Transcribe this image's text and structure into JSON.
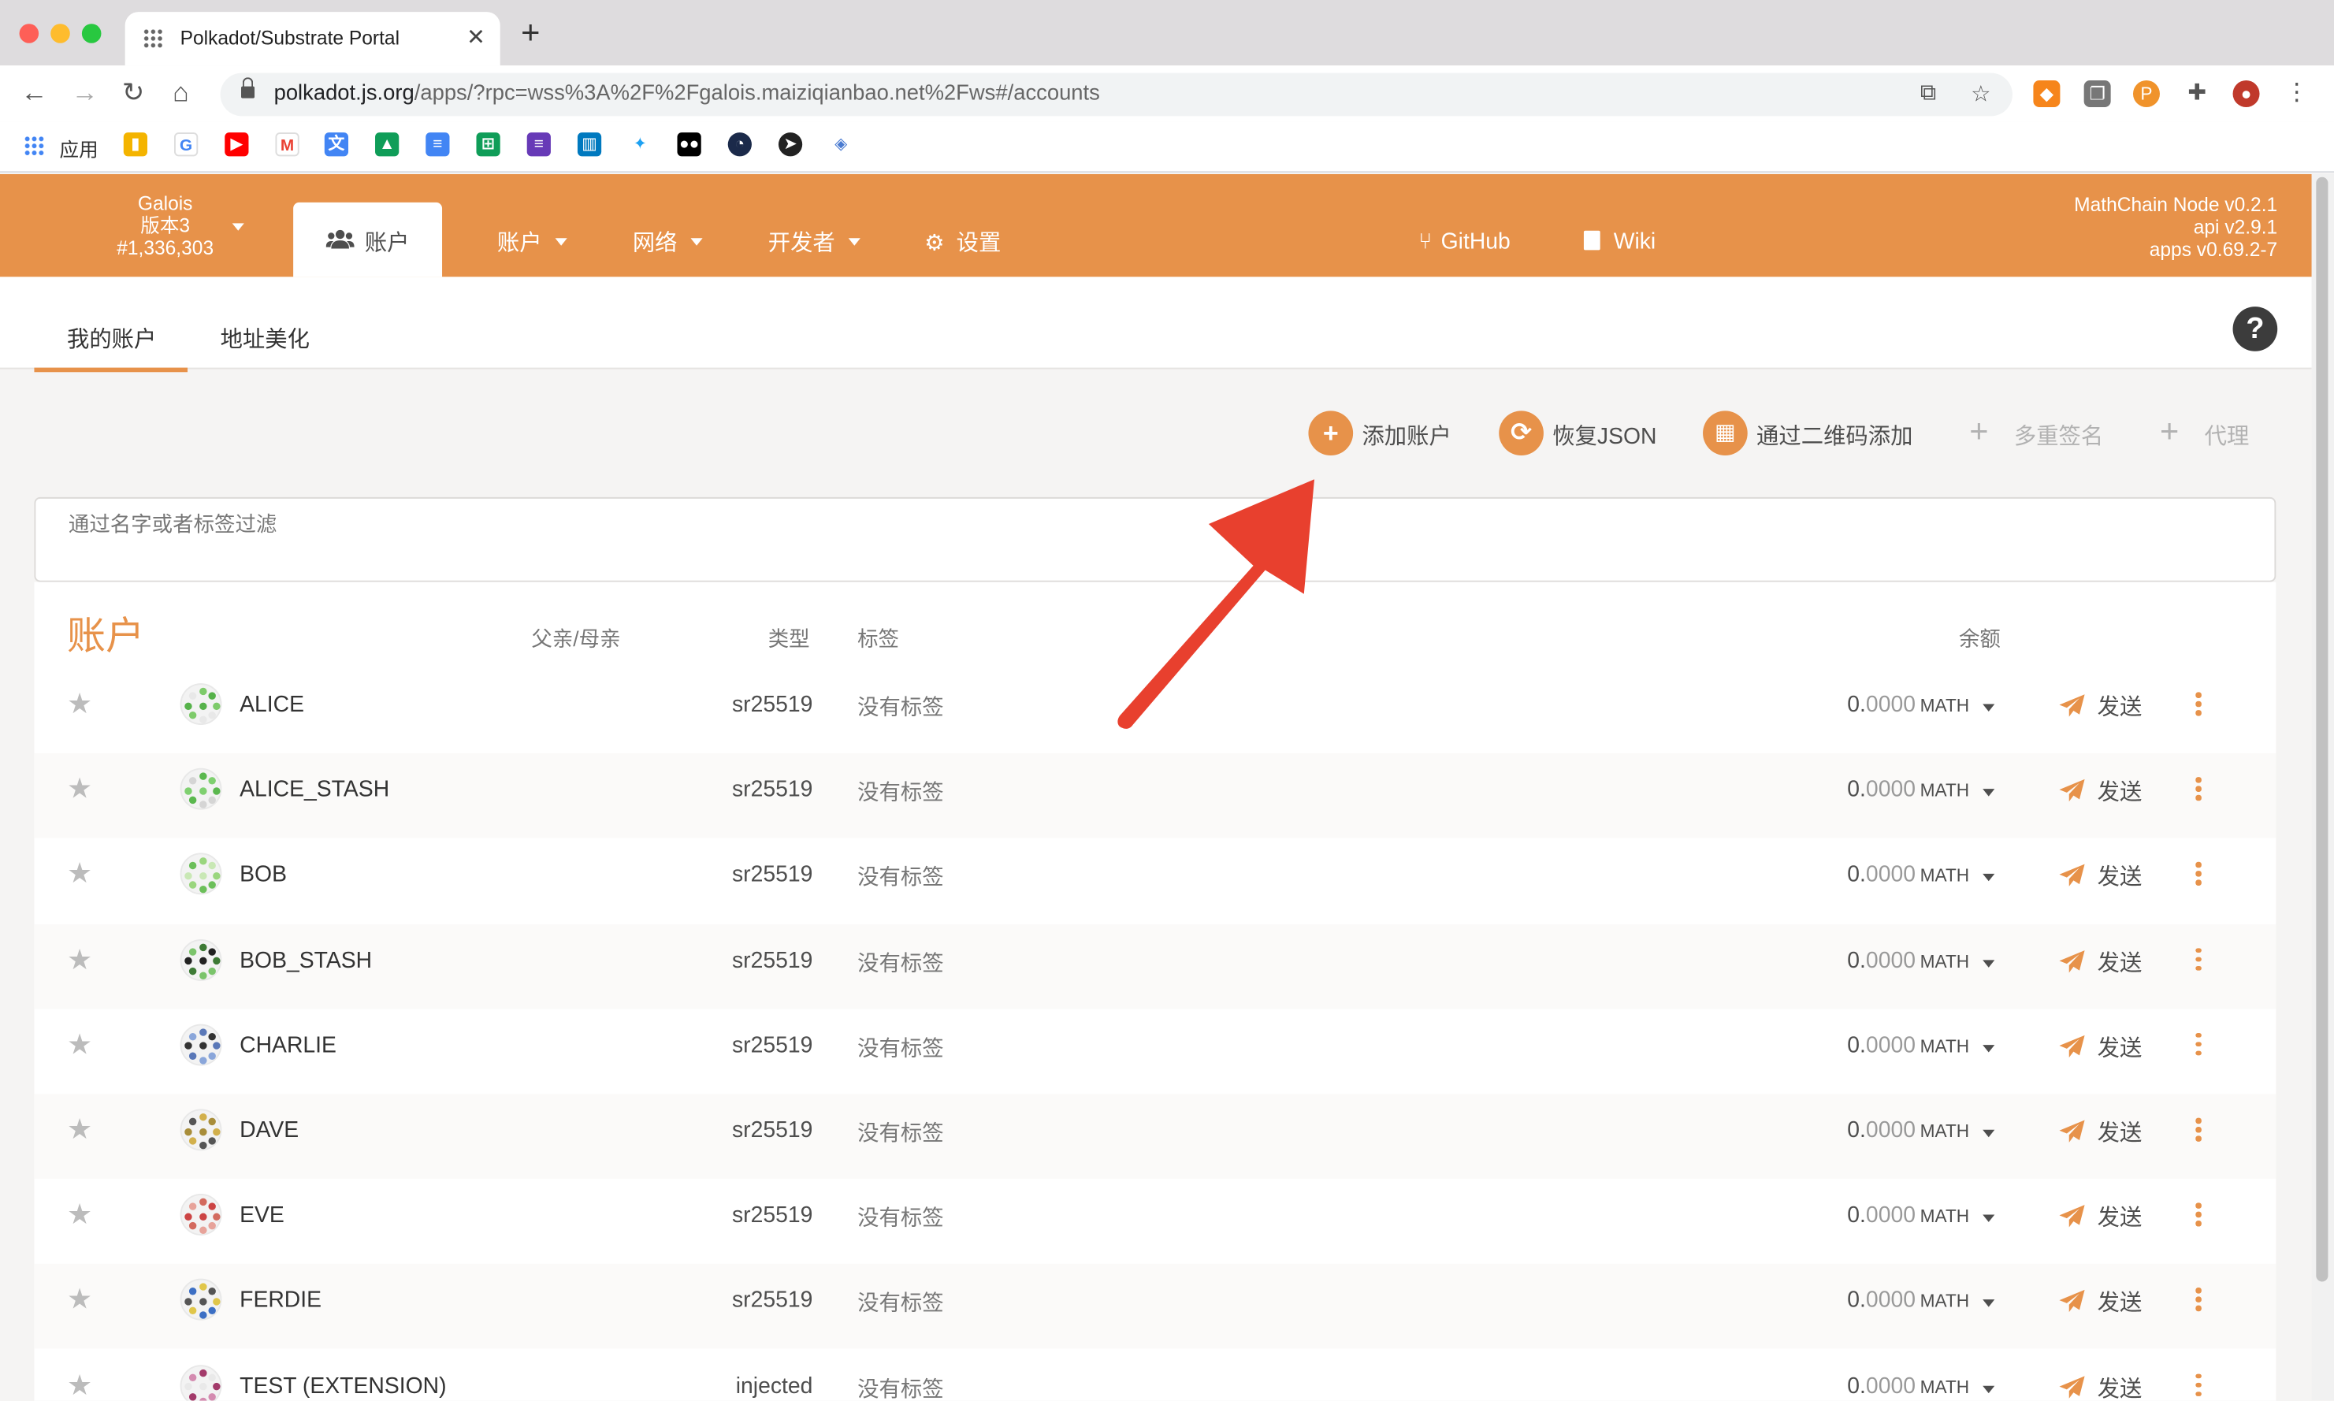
{
  "browser": {
    "tab_title": "Polkadot/Substrate Portal",
    "url_host": "polkadot.js.org",
    "url_path": "/apps/?rpc=wss%3A%2F%2Fgalois.maiziqianbao.net%2Fws#/accounts",
    "bookmarks_label": "应用"
  },
  "header": {
    "chain_name": "Galois",
    "chain_version": "版本3",
    "block_number": "#1,336,303",
    "active_menu": "账户",
    "menu": {
      "accounts": "账户",
      "network": "网络",
      "developer": "开发者",
      "settings": "设置",
      "github": "GitHub",
      "wiki": "Wiki"
    },
    "versions": {
      "node": "MathChain Node v0.2.1",
      "api": "api v2.9.1",
      "apps": "apps v0.69.2-7"
    }
  },
  "subtabs": {
    "my_accounts": "我的账户",
    "vanity": "地址美化",
    "help": "?"
  },
  "actions": {
    "add_account": "添加账户",
    "restore_json": "恢复JSON",
    "add_via_qr": "通过二维码添加",
    "multisig": "多重签名",
    "proxy": "代理"
  },
  "filter": {
    "placeholder": "通过名字或者标签过滤"
  },
  "table": {
    "title": "账户",
    "columns": {
      "parent": "父亲/母亲",
      "type": "类型",
      "tags": "标签",
      "balance": "余额"
    },
    "rows": [
      {
        "name": "ALICE",
        "type": "sr25519",
        "tags": "没有标签",
        "balance_int": "0.",
        "balance_dec": "0000",
        "unit": "MATH",
        "send": "发送"
      },
      {
        "name": "ALICE_STASH",
        "type": "sr25519",
        "tags": "没有标签",
        "balance_int": "0.",
        "balance_dec": "0000",
        "unit": "MATH",
        "send": "发送"
      },
      {
        "name": "BOB",
        "type": "sr25519",
        "tags": "没有标签",
        "balance_int": "0.",
        "balance_dec": "0000",
        "unit": "MATH",
        "send": "发送"
      },
      {
        "name": "BOB_STASH",
        "type": "sr25519",
        "tags": "没有标签",
        "balance_int": "0.",
        "balance_dec": "0000",
        "unit": "MATH",
        "send": "发送"
      },
      {
        "name": "CHARLIE",
        "type": "sr25519",
        "tags": "没有标签",
        "balance_int": "0.",
        "balance_dec": "0000",
        "unit": "MATH",
        "send": "发送"
      },
      {
        "name": "DAVE",
        "type": "sr25519",
        "tags": "没有标签",
        "balance_int": "0.",
        "balance_dec": "0000",
        "unit": "MATH",
        "send": "发送"
      },
      {
        "name": "EVE",
        "type": "sr25519",
        "tags": "没有标签",
        "balance_int": "0.",
        "balance_dec": "0000",
        "unit": "MATH",
        "send": "发送"
      },
      {
        "name": "FERDIE",
        "type": "sr25519",
        "tags": "没有标签",
        "balance_int": "0.",
        "balance_dec": "0000",
        "unit": "MATH",
        "send": "发送"
      },
      {
        "name": "TEST (EXTENSION)",
        "type": "injected",
        "tags": "没有标签",
        "balance_int": "0.",
        "balance_dec": "0000",
        "unit": "MATH",
        "send": "发送"
      }
    ]
  },
  "colors": {
    "accent": "#e7924a",
    "annotation_arrow": "#e8402e"
  }
}
